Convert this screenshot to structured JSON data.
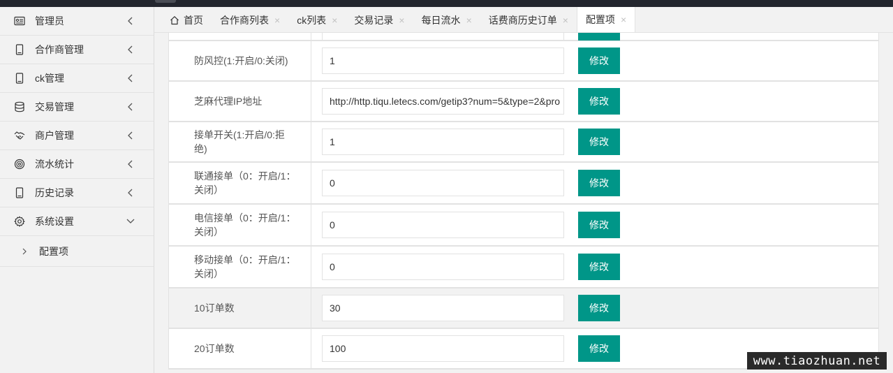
{
  "sidebar": {
    "items": [
      {
        "label": "管理员",
        "icon": "id-card-icon"
      },
      {
        "label": "合作商管理",
        "icon": "phone-icon"
      },
      {
        "label": "ck管理",
        "icon": "phone-icon"
      },
      {
        "label": "交易管理",
        "icon": "database-icon"
      },
      {
        "label": "商户管理",
        "icon": "handshake-icon"
      },
      {
        "label": "流水统计",
        "icon": "target-icon"
      },
      {
        "label": "历史记录",
        "icon": "phone-icon"
      },
      {
        "label": "系统设置",
        "icon": "gear-icon"
      }
    ],
    "sub_items": [
      {
        "label": "配置项"
      }
    ]
  },
  "tabs": [
    {
      "label": "首页",
      "closable": false
    },
    {
      "label": "合作商列表",
      "closable": true
    },
    {
      "label": "ck列表",
      "closable": true
    },
    {
      "label": "交易记录",
      "closable": true
    },
    {
      "label": "每日流水",
      "closable": true
    },
    {
      "label": "话费商历史订单",
      "closable": true
    },
    {
      "label": "配置项",
      "closable": true,
      "active": true
    }
  ],
  "tab_close_glyph": "×",
  "config": {
    "button_label": "修改",
    "rows": [
      {
        "label": "防风控(1:开启/0:关闭)",
        "value": "1"
      },
      {
        "label": "芝麻代理IP地址",
        "value": "http://http.tiqu.letecs.com/getip3?num=5&type=2&pro"
      },
      {
        "label": "接单开关(1:开启/0:拒绝)",
        "value": "1"
      },
      {
        "label": "联通接单（0：开启/1：关闭）",
        "value": "0"
      },
      {
        "label": "电信接单（0：开启/1：关闭）",
        "value": "0"
      },
      {
        "label": "移动接单（0：开启/1：关闭）",
        "value": "0"
      },
      {
        "label": "10订单数",
        "value": "30",
        "highlighted": true
      },
      {
        "label": "20订单数",
        "value": "100"
      }
    ]
  },
  "watermark": "www.tiaozhuan.net",
  "colors": {
    "accent": "#009688",
    "topbar": "#23262e",
    "sidebar_bg": "#f2f2f2"
  }
}
